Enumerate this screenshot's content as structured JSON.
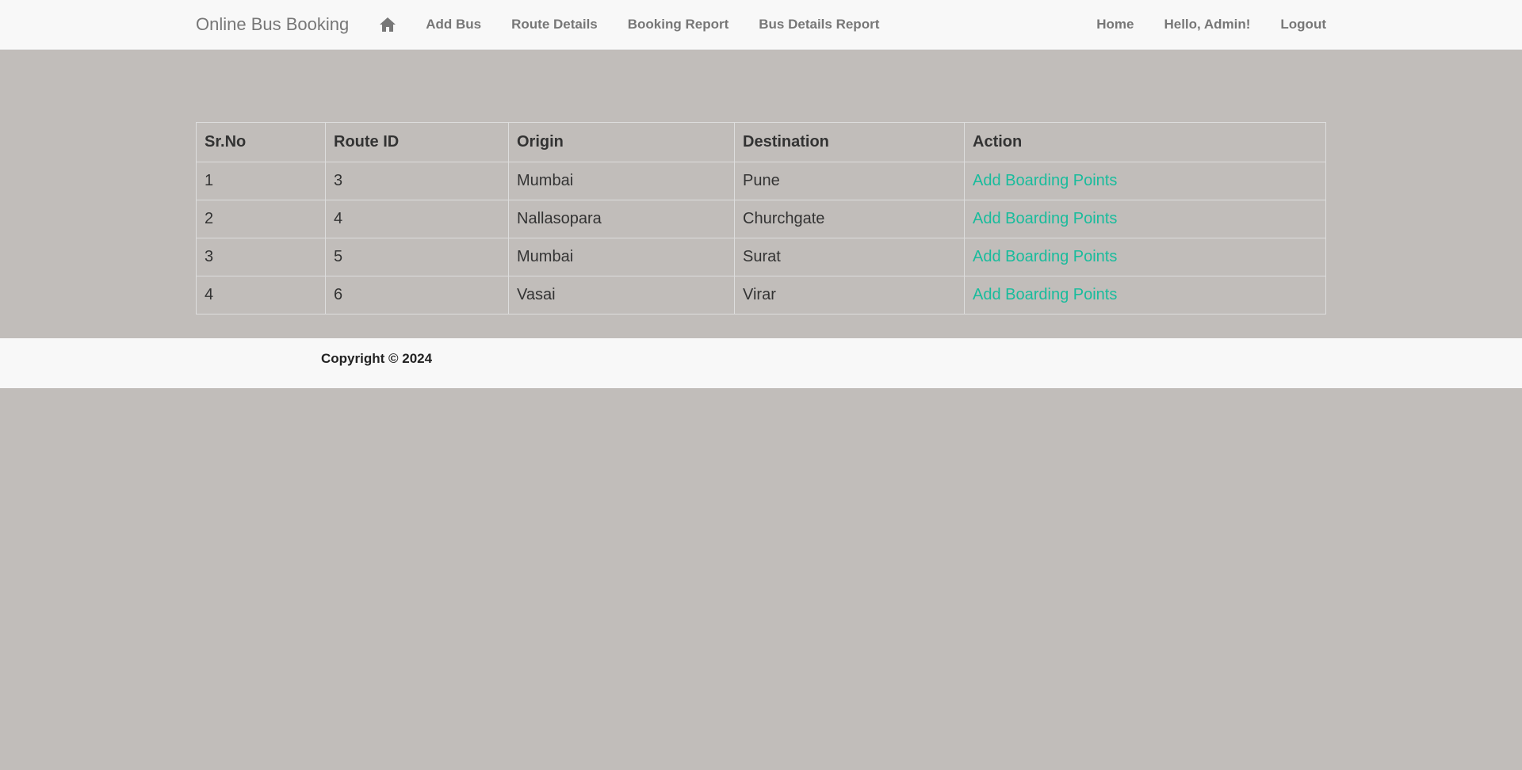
{
  "navbar": {
    "brand": "Online Bus Booking",
    "home_icon": "home-icon",
    "left_links": [
      "Add Bus",
      "Route Details",
      "Booking Report",
      "Bus Details Report"
    ],
    "right_links": [
      "Home",
      "Hello, Admin!",
      "Logout"
    ]
  },
  "table": {
    "headers": [
      "Sr.No",
      "Route ID",
      "Origin",
      "Destination",
      "Action"
    ],
    "rows": [
      {
        "sr": "1",
        "route_id": "3",
        "origin": "Mumbai",
        "destination": "Pune",
        "action": "Add Boarding Points"
      },
      {
        "sr": "2",
        "route_id": "4",
        "origin": "Nallasopara",
        "destination": "Churchgate",
        "action": "Add Boarding Points"
      },
      {
        "sr": "3",
        "route_id": "5",
        "origin": "Mumbai",
        "destination": "Surat",
        "action": "Add Boarding Points"
      },
      {
        "sr": "4",
        "route_id": "6",
        "origin": "Vasai",
        "destination": "Virar",
        "action": "Add Boarding Points"
      }
    ]
  },
  "footer": {
    "copyright": "Copyright © 2024"
  },
  "colors": {
    "background": "#c1bdba",
    "navbar_bg": "#f8f8f8",
    "link_accent": "#18bc9c",
    "nav_text": "#777777"
  }
}
